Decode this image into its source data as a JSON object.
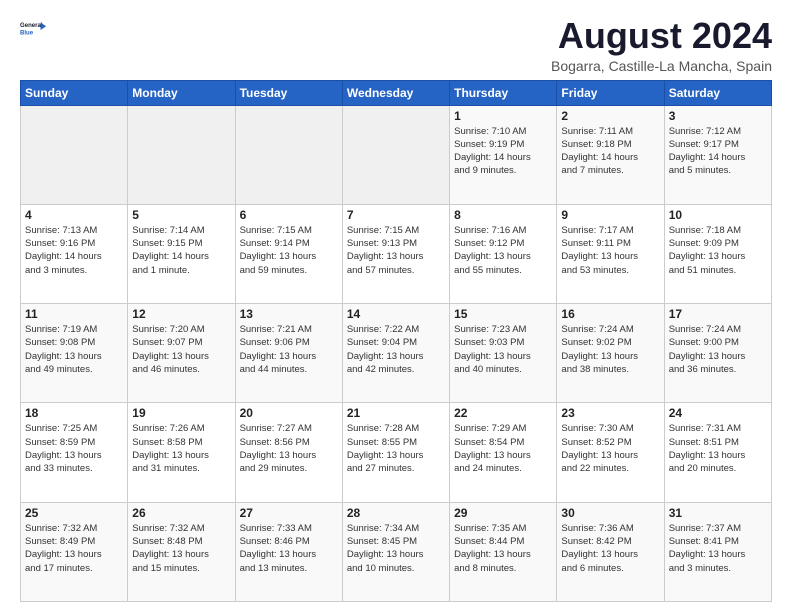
{
  "logo": {
    "line1": "General",
    "line2": "Blue"
  },
  "title": "August 2024",
  "subtitle": "Bogarra, Castille-La Mancha, Spain",
  "days_of_week": [
    "Sunday",
    "Monday",
    "Tuesday",
    "Wednesday",
    "Thursday",
    "Friday",
    "Saturday"
  ],
  "weeks": [
    [
      {
        "day": "",
        "text": ""
      },
      {
        "day": "",
        "text": ""
      },
      {
        "day": "",
        "text": ""
      },
      {
        "day": "",
        "text": ""
      },
      {
        "day": "1",
        "text": "Sunrise: 7:10 AM\nSunset: 9:19 PM\nDaylight: 14 hours\nand 9 minutes."
      },
      {
        "day": "2",
        "text": "Sunrise: 7:11 AM\nSunset: 9:18 PM\nDaylight: 14 hours\nand 7 minutes."
      },
      {
        "day": "3",
        "text": "Sunrise: 7:12 AM\nSunset: 9:17 PM\nDaylight: 14 hours\nand 5 minutes."
      }
    ],
    [
      {
        "day": "4",
        "text": "Sunrise: 7:13 AM\nSunset: 9:16 PM\nDaylight: 14 hours\nand 3 minutes."
      },
      {
        "day": "5",
        "text": "Sunrise: 7:14 AM\nSunset: 9:15 PM\nDaylight: 14 hours\nand 1 minute."
      },
      {
        "day": "6",
        "text": "Sunrise: 7:15 AM\nSunset: 9:14 PM\nDaylight: 13 hours\nand 59 minutes."
      },
      {
        "day": "7",
        "text": "Sunrise: 7:15 AM\nSunset: 9:13 PM\nDaylight: 13 hours\nand 57 minutes."
      },
      {
        "day": "8",
        "text": "Sunrise: 7:16 AM\nSunset: 9:12 PM\nDaylight: 13 hours\nand 55 minutes."
      },
      {
        "day": "9",
        "text": "Sunrise: 7:17 AM\nSunset: 9:11 PM\nDaylight: 13 hours\nand 53 minutes."
      },
      {
        "day": "10",
        "text": "Sunrise: 7:18 AM\nSunset: 9:09 PM\nDaylight: 13 hours\nand 51 minutes."
      }
    ],
    [
      {
        "day": "11",
        "text": "Sunrise: 7:19 AM\nSunset: 9:08 PM\nDaylight: 13 hours\nand 49 minutes."
      },
      {
        "day": "12",
        "text": "Sunrise: 7:20 AM\nSunset: 9:07 PM\nDaylight: 13 hours\nand 46 minutes."
      },
      {
        "day": "13",
        "text": "Sunrise: 7:21 AM\nSunset: 9:06 PM\nDaylight: 13 hours\nand 44 minutes."
      },
      {
        "day": "14",
        "text": "Sunrise: 7:22 AM\nSunset: 9:04 PM\nDaylight: 13 hours\nand 42 minutes."
      },
      {
        "day": "15",
        "text": "Sunrise: 7:23 AM\nSunset: 9:03 PM\nDaylight: 13 hours\nand 40 minutes."
      },
      {
        "day": "16",
        "text": "Sunrise: 7:24 AM\nSunset: 9:02 PM\nDaylight: 13 hours\nand 38 minutes."
      },
      {
        "day": "17",
        "text": "Sunrise: 7:24 AM\nSunset: 9:00 PM\nDaylight: 13 hours\nand 36 minutes."
      }
    ],
    [
      {
        "day": "18",
        "text": "Sunrise: 7:25 AM\nSunset: 8:59 PM\nDaylight: 13 hours\nand 33 minutes."
      },
      {
        "day": "19",
        "text": "Sunrise: 7:26 AM\nSunset: 8:58 PM\nDaylight: 13 hours\nand 31 minutes."
      },
      {
        "day": "20",
        "text": "Sunrise: 7:27 AM\nSunset: 8:56 PM\nDaylight: 13 hours\nand 29 minutes."
      },
      {
        "day": "21",
        "text": "Sunrise: 7:28 AM\nSunset: 8:55 PM\nDaylight: 13 hours\nand 27 minutes."
      },
      {
        "day": "22",
        "text": "Sunrise: 7:29 AM\nSunset: 8:54 PM\nDaylight: 13 hours\nand 24 minutes."
      },
      {
        "day": "23",
        "text": "Sunrise: 7:30 AM\nSunset: 8:52 PM\nDaylight: 13 hours\nand 22 minutes."
      },
      {
        "day": "24",
        "text": "Sunrise: 7:31 AM\nSunset: 8:51 PM\nDaylight: 13 hours\nand 20 minutes."
      }
    ],
    [
      {
        "day": "25",
        "text": "Sunrise: 7:32 AM\nSunset: 8:49 PM\nDaylight: 13 hours\nand 17 minutes."
      },
      {
        "day": "26",
        "text": "Sunrise: 7:32 AM\nSunset: 8:48 PM\nDaylight: 13 hours\nand 15 minutes."
      },
      {
        "day": "27",
        "text": "Sunrise: 7:33 AM\nSunset: 8:46 PM\nDaylight: 13 hours\nand 13 minutes."
      },
      {
        "day": "28",
        "text": "Sunrise: 7:34 AM\nSunset: 8:45 PM\nDaylight: 13 hours\nand 10 minutes."
      },
      {
        "day": "29",
        "text": "Sunrise: 7:35 AM\nSunset: 8:44 PM\nDaylight: 13 hours\nand 8 minutes."
      },
      {
        "day": "30",
        "text": "Sunrise: 7:36 AM\nSunset: 8:42 PM\nDaylight: 13 hours\nand 6 minutes."
      },
      {
        "day": "31",
        "text": "Sunrise: 7:37 AM\nSunset: 8:41 PM\nDaylight: 13 hours\nand 3 minutes."
      }
    ]
  ]
}
